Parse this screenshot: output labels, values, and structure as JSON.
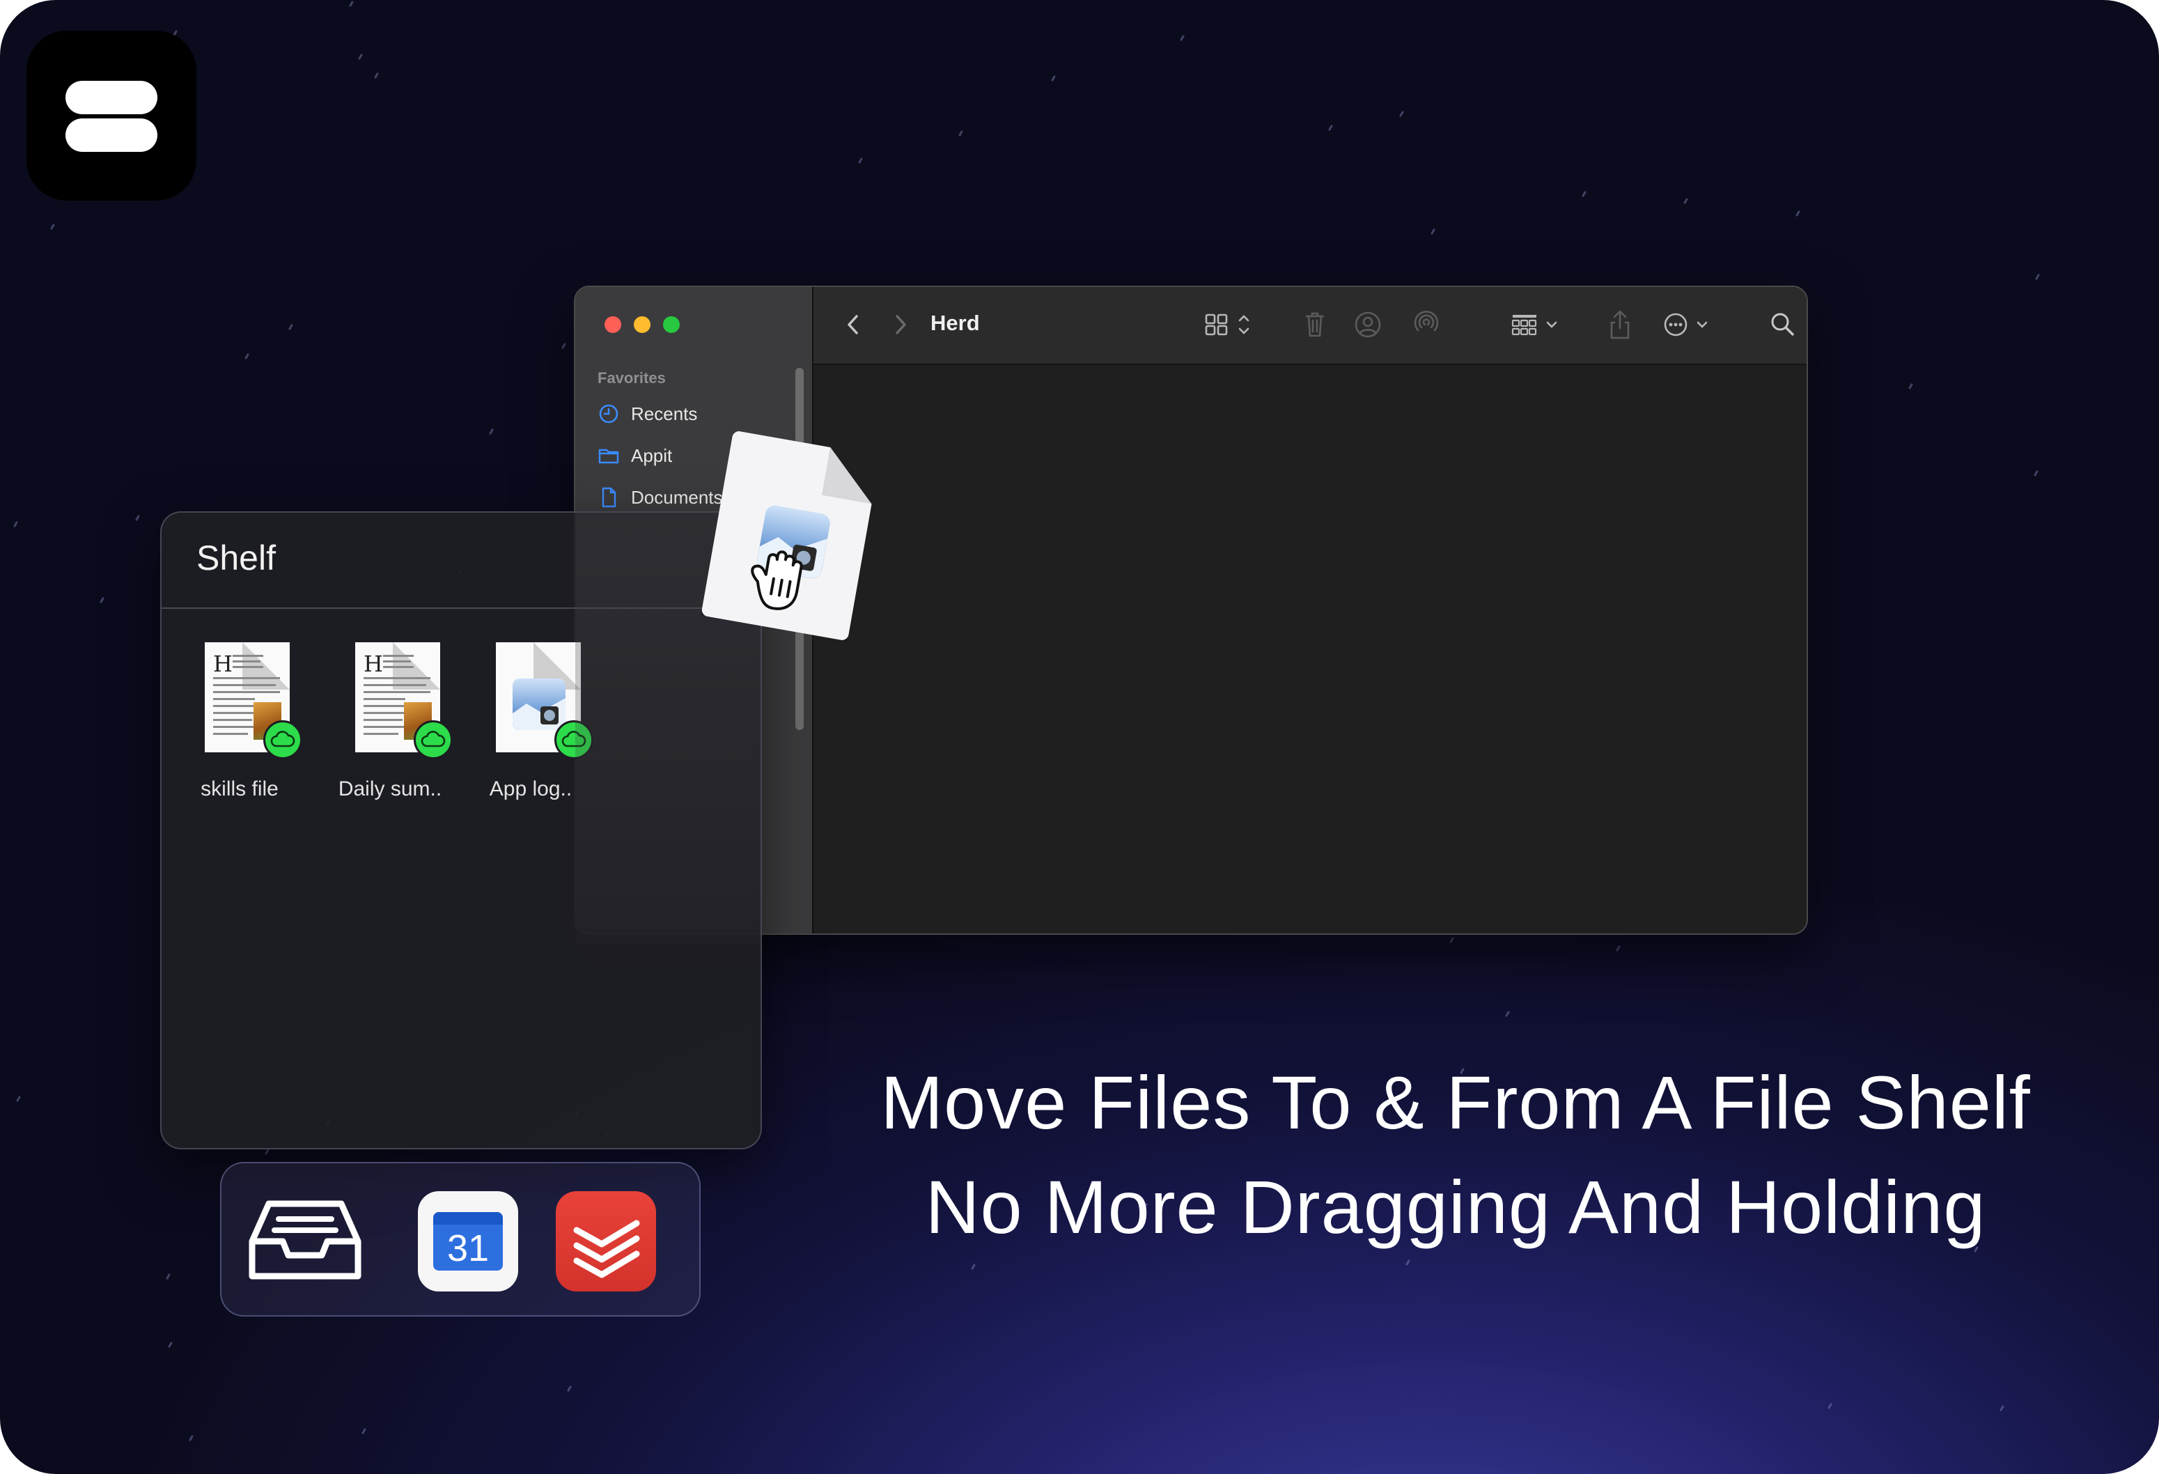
{
  "finder": {
    "title": "Herd",
    "sidebar_heading": "Favorites",
    "sidebar_items": [
      {
        "label": "Recents",
        "icon": "clock-icon"
      },
      {
        "label": "Appit",
        "icon": "folder-icon"
      },
      {
        "label": "Documents",
        "icon": "document-icon"
      }
    ],
    "toolbar_icons": [
      "chevron-left-icon",
      "chevron-right-icon",
      "icon-view-icon",
      "trash-icon",
      "share-person-icon",
      "airdrop-icon",
      "group-icon",
      "share-icon",
      "more-icon",
      "search-icon"
    ]
  },
  "shelf": {
    "title": "Shelf",
    "files": [
      {
        "label": "skills file",
        "type": "text-document",
        "badge": "cloud"
      },
      {
        "label": "Daily sum..",
        "type": "text-document",
        "badge": "cloud"
      },
      {
        "label": "App log..",
        "type": "preview-document",
        "badge": "cloud"
      }
    ]
  },
  "dock": {
    "apps": [
      {
        "name": "inbox-tray-icon"
      },
      {
        "name": "google-calendar-icon",
        "text": "31"
      },
      {
        "name": "todoist-icon"
      }
    ]
  },
  "headline": {
    "line1": "Move Files To & From A File Shelf",
    "line2": "No More Dragging And Holding"
  },
  "colors": {
    "badge_green": "#2ddc4a",
    "background_deep": "#0b0b1e",
    "background_glow": "#3a3a9a",
    "traffic_red": "#fe5f57",
    "traffic_yellow": "#febc2e",
    "traffic_green": "#28c840"
  }
}
